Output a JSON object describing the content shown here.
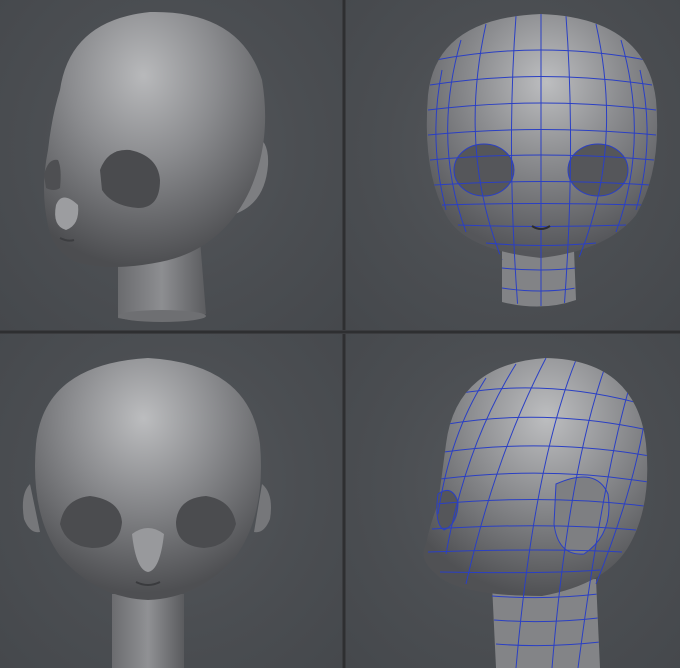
{
  "viewports": [
    {
      "id": "perspective-shaded",
      "view": "three-quarter",
      "wireframe": false
    },
    {
      "id": "front-wireframe",
      "view": "front",
      "wireframe": true
    },
    {
      "id": "front-shaded",
      "view": "front",
      "wireframe": false
    },
    {
      "id": "side-wireframe",
      "view": "three-quarter-side",
      "wireframe": true
    }
  ],
  "colors": {
    "background": "#4b4e52",
    "mesh_surface": "#8e8f92",
    "wire": "#2a3fc4",
    "divider": "#2e2f31"
  }
}
